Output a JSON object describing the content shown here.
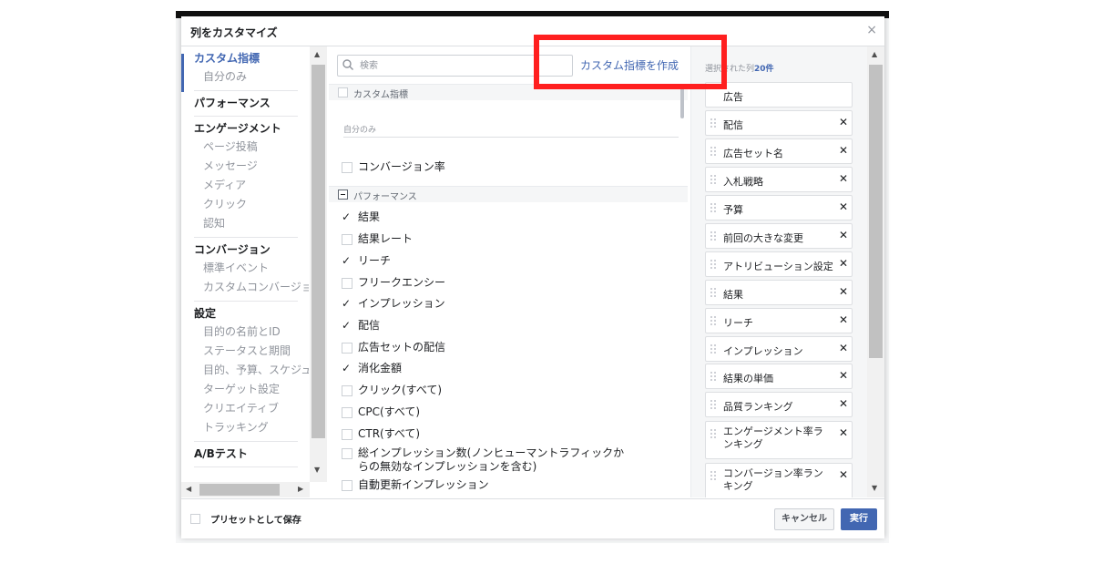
{
  "dialog": {
    "title": "列をカスタマイズ",
    "close_label": "×"
  },
  "nav": {
    "groups": [
      {
        "title": "カスタム指標",
        "items": [
          "自分のみ"
        ]
      },
      {
        "title": "パフォーマンス",
        "items": []
      },
      {
        "title": "エンゲージメント",
        "items": [
          "ページ投稿",
          "メッセージ",
          "メディア",
          "クリック",
          "認知"
        ]
      },
      {
        "title": "コンバージョン",
        "items": [
          "標準イベント",
          "カスタムコンバージョン"
        ]
      },
      {
        "title": "設定",
        "items": [
          "目的の名前とID",
          "ステータスと期間",
          "目的、予算、スケジュール",
          "ターゲット設定",
          "クリエイティブ",
          "トラッキング"
        ]
      },
      {
        "title": "A/Bテスト",
        "items": []
      }
    ]
  },
  "search": {
    "placeholder": "検索"
  },
  "create_custom_metric": "カスタム指標を作成",
  "sections": {
    "custom_header": "カスタム指標",
    "only_me": "自分のみ",
    "performance_header": "パフォーマンス"
  },
  "options": [
    {
      "label": "コンバージョン率",
      "checked": false
    },
    {
      "label": "結果",
      "checked": true
    },
    {
      "label": "結果レート",
      "checked": false
    },
    {
      "label": "リーチ",
      "checked": true
    },
    {
      "label": "フリークエンシー",
      "checked": false
    },
    {
      "label": "インプレッション",
      "checked": true
    },
    {
      "label": "配信",
      "checked": true
    },
    {
      "label": "広告セットの配信",
      "checked": false
    },
    {
      "label": "消化金額",
      "checked": true
    },
    {
      "label": "クリック(すべて)",
      "checked": false
    },
    {
      "label": "CPC(すべて)",
      "checked": false
    },
    {
      "label": "CTR(すべて)",
      "checked": false
    },
    {
      "label": "総インプレッション数(ノンヒューマントラフィックからの無効なインプレッションを含む)",
      "checked": false
    },
    {
      "label": "自動更新インプレッション",
      "checked": false
    },
    {
      "label": "アトリビューション設定",
      "checked": true
    }
  ],
  "selected": {
    "header_prefix": "選択された列",
    "count": "20件",
    "items": [
      "広告",
      "配信",
      "広告セット名",
      "入札戦略",
      "予算",
      "前回の大きな変更",
      "アトリビューション設定",
      "結果",
      "リーチ",
      "インプレッション",
      "結果の単価",
      "品質ランキング",
      "エンゲージメント率ランキング",
      "コンバージョン率ランキング"
    ]
  },
  "footer": {
    "save_preset": "プリセットとして保存",
    "cancel": "キャンセル",
    "run": "実行"
  },
  "colors": {
    "accent": "#4267b2",
    "highlight": "#ff1f1f"
  }
}
